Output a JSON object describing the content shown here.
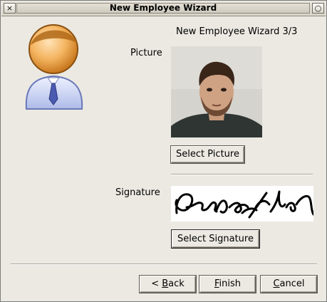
{
  "window": {
    "title": "New Employee Wizard",
    "close_glyph": "×",
    "maximize_glyph": "○"
  },
  "wizard": {
    "step_title": "New Employee Wizard 3/3",
    "picture_label": "Picture",
    "select_picture_label": "Select Picture",
    "signature_label": "Signature",
    "select_signature_label": "Select Signature"
  },
  "nav": {
    "back_prefix": "< ",
    "back_mnemonic": "B",
    "back_rest": "ack",
    "finish_mnemonic": "F",
    "finish_rest": "inish",
    "cancel_mnemonic": "C",
    "cancel_rest": "ancel"
  },
  "icons": {
    "header": "user-icon",
    "close": "close-icon",
    "maximize": "maximize-icon"
  },
  "colors": {
    "window_bg": "#ebe9e2",
    "user_head": "#f0a040",
    "user_body": "#c8d4f4",
    "user_tie": "#4a5ab0"
  }
}
